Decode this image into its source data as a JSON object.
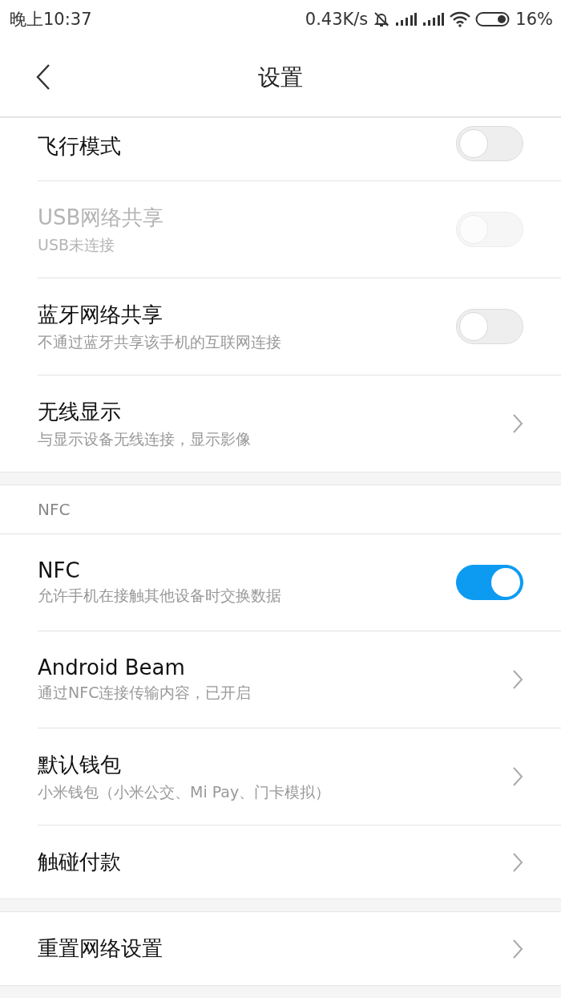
{
  "status_bar": {
    "time": "晚上10:37",
    "speed": "0.43K/s",
    "battery": "16%"
  },
  "header": {
    "title": "设置"
  },
  "sections": [
    {
      "items": [
        {
          "kind": "toggle",
          "title": "飞行模式",
          "on": false,
          "disabled": false,
          "compact": true
        },
        {
          "kind": "toggle",
          "title": "USB网络共享",
          "subtitle": "USB未连接",
          "on": false,
          "disabled": true
        },
        {
          "kind": "toggle",
          "title": "蓝牙网络共享",
          "subtitle": "不通过蓝牙共享该手机的互联网连接",
          "on": false,
          "disabled": false
        },
        {
          "kind": "arrow",
          "title": "无线显示",
          "subtitle": "与显示设备无线连接，显示影像"
        }
      ]
    },
    {
      "heading": "NFC",
      "items": [
        {
          "kind": "toggle",
          "title": "NFC",
          "subtitle": "允许手机在接触其他设备时交换数据",
          "on": true,
          "disabled": false
        },
        {
          "kind": "arrow",
          "title": "Android Beam",
          "subtitle": "通过NFC连接传输内容，已开启"
        },
        {
          "kind": "arrow",
          "title": "默认钱包",
          "subtitle": "小米钱包（小米公交、Mi Pay、门卡模拟）"
        },
        {
          "kind": "arrow",
          "title": "触碰付款"
        }
      ]
    },
    {
      "items": [
        {
          "kind": "arrow",
          "title": "重置网络设置"
        }
      ]
    }
  ]
}
